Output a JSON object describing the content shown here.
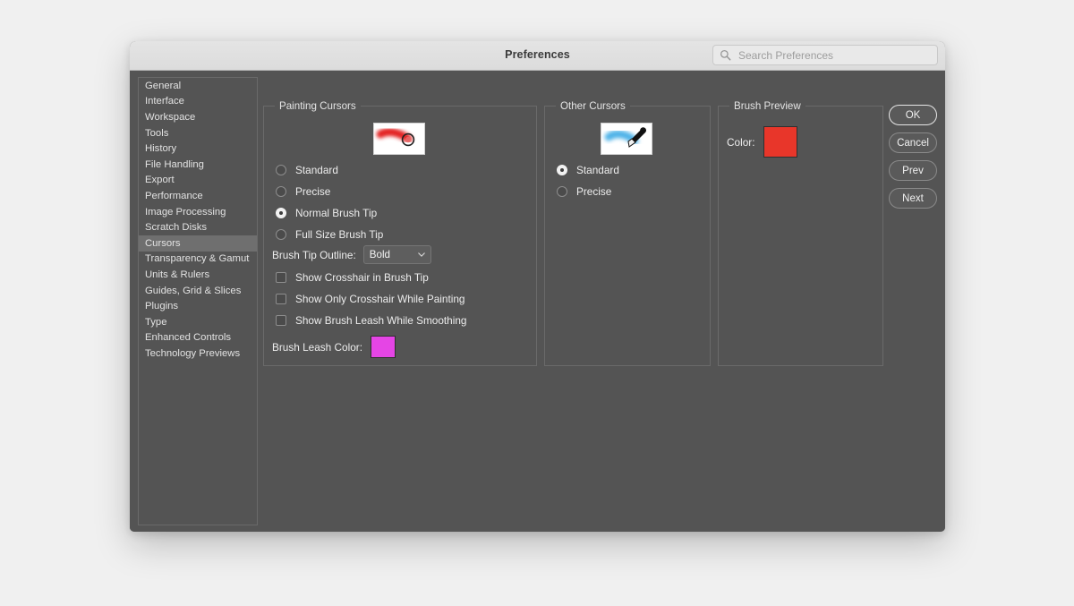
{
  "window": {
    "title": "Preferences",
    "search": {
      "placeholder": "Search Preferences",
      "value": ""
    }
  },
  "colors": {
    "dialog_bg": "#545454",
    "titlebar_bg": "#e0e0e0",
    "selected_row": "#6f6f6f",
    "brush_leash_color": "#e545e5",
    "brush_preview_color": "#e8362a",
    "page_bg": "#f0f0f0"
  },
  "sidebar": {
    "items": [
      {
        "label": "General",
        "selected": false
      },
      {
        "label": "Interface",
        "selected": false
      },
      {
        "label": "Workspace",
        "selected": false
      },
      {
        "label": "Tools",
        "selected": false
      },
      {
        "label": "History",
        "selected": false
      },
      {
        "label": "File Handling",
        "selected": false
      },
      {
        "label": "Export",
        "selected": false
      },
      {
        "label": "Performance",
        "selected": false
      },
      {
        "label": "Image Processing",
        "selected": false
      },
      {
        "label": "Scratch Disks",
        "selected": false
      },
      {
        "label": "Cursors",
        "selected": true
      },
      {
        "label": "Transparency & Gamut",
        "selected": false
      },
      {
        "label": "Units & Rulers",
        "selected": false
      },
      {
        "label": "Guides, Grid & Slices",
        "selected": false
      },
      {
        "label": "Plugins",
        "selected": false
      },
      {
        "label": "Type",
        "selected": false
      },
      {
        "label": "Enhanced Controls",
        "selected": false
      },
      {
        "label": "Technology Previews",
        "selected": false
      }
    ]
  },
  "painting_cursors": {
    "title": "Painting Cursors",
    "preview_alt": "red-brush-stroke-with-circle-cursor",
    "radios": [
      {
        "label": "Standard",
        "selected": false
      },
      {
        "label": "Precise",
        "selected": false
      },
      {
        "label": "Normal Brush Tip",
        "selected": true
      },
      {
        "label": "Full Size Brush Tip",
        "selected": false
      }
    ],
    "brush_tip_outline": {
      "label": "Brush Tip Outline:",
      "value": "Bold"
    },
    "checkboxes": [
      {
        "label": "Show Crosshair in Brush Tip",
        "checked": false
      },
      {
        "label": "Show Only Crosshair While Painting",
        "checked": false
      },
      {
        "label": "Show Brush Leash While Smoothing",
        "checked": false
      }
    ],
    "brush_leash": {
      "label": "Brush Leash Color:",
      "color": "#e545e5"
    }
  },
  "other_cursors": {
    "title": "Other Cursors",
    "preview_alt": "blue-stroke-with-eyedropper-cursor",
    "radios": [
      {
        "label": "Standard",
        "selected": true
      },
      {
        "label": "Precise",
        "selected": false
      }
    ]
  },
  "brush_preview": {
    "title": "Brush Preview",
    "color_label": "Color:",
    "color": "#e8362a"
  },
  "buttons": [
    {
      "label": "OK",
      "default": true
    },
    {
      "label": "Cancel",
      "default": false
    },
    {
      "label": "Prev",
      "default": false
    },
    {
      "label": "Next",
      "default": false
    }
  ]
}
